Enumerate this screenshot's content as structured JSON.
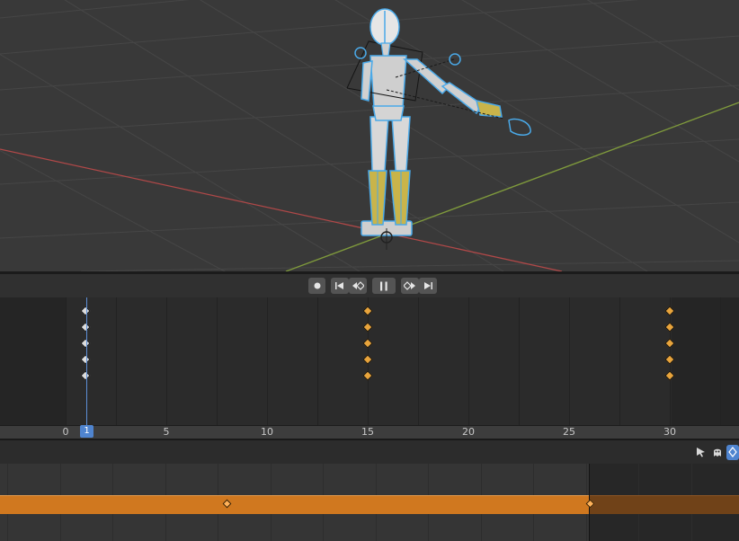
{
  "viewport": {
    "axis_colors": {
      "x_axis": "#b04848",
      "y_axis": "#7f9a3c"
    },
    "selection_color": "#4aa9e8"
  },
  "transport": {
    "record_icon": "record-dot-icon",
    "jump_start_icon": "jump-to-start-icon",
    "prev_keyframe_icon": "previous-keyframe-icon",
    "pause_icon": "pause-icon",
    "next_keyframe_icon": "next-keyframe-icon",
    "jump_end_icon": "jump-to-end-icon"
  },
  "dopesheet": {
    "channel_rows": 5,
    "keyframe_columns": [
      {
        "frame": 1,
        "selected": false
      },
      {
        "frame": 15,
        "selected": true
      },
      {
        "frame": 30,
        "selected": true
      }
    ]
  },
  "timeline": {
    "tick_labels": [
      "0",
      "5",
      "10",
      "15",
      "20",
      "25",
      "30"
    ],
    "current_frame": "1"
  },
  "nla": {
    "header_icons": [
      "cursor-icon",
      "ghost-icon",
      "keyframe-filter-icon"
    ],
    "strip_color": "#d0781f",
    "strip_end_frame": 26,
    "strip_keys": [
      10,
      26
    ]
  }
}
